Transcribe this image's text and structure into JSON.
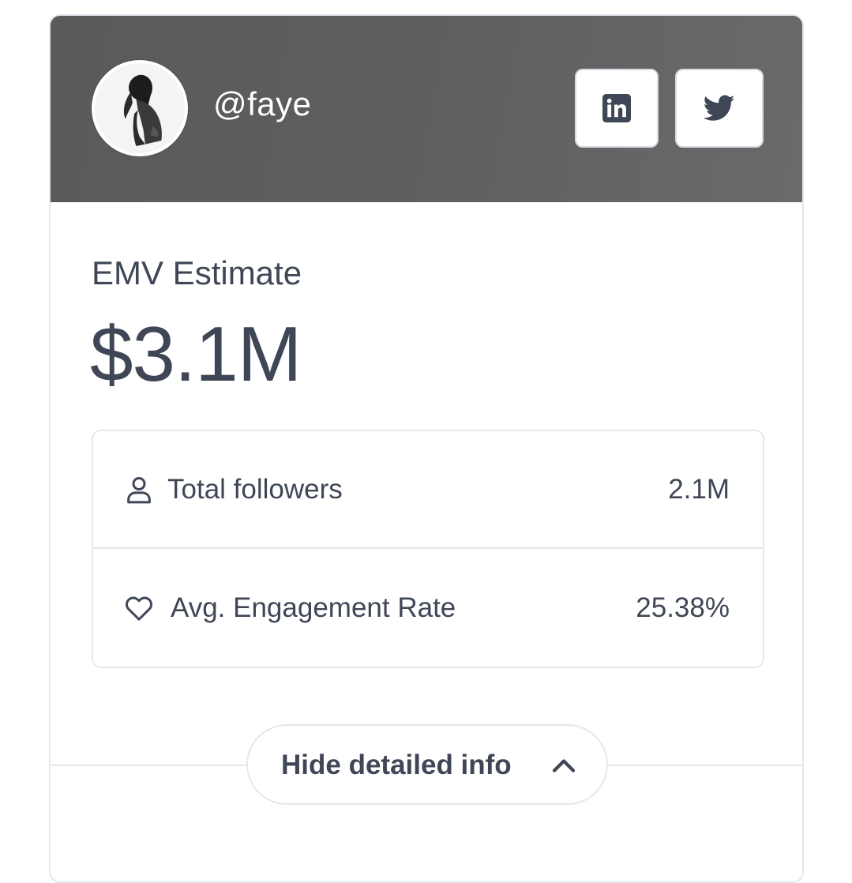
{
  "profile": {
    "handle": "@faye",
    "avatar_icon": "profile-photo"
  },
  "social": {
    "linkedin_icon": "linkedin-icon",
    "twitter_icon": "twitter-icon"
  },
  "emv": {
    "label": "EMV Estimate",
    "value": "$3.1M"
  },
  "stats": [
    {
      "icon": "user-icon",
      "label": "Total followers",
      "value": "2.1M"
    },
    {
      "icon": "heart-icon",
      "label": "Avg. Engagement Rate",
      "value": "25.38%"
    }
  ],
  "toggle": {
    "label": "Hide detailed info",
    "icon": "chevron-up-icon"
  },
  "colors": {
    "header_bg": "#5e5e5e",
    "text": "#3f4656",
    "border": "#e3e8ef"
  }
}
